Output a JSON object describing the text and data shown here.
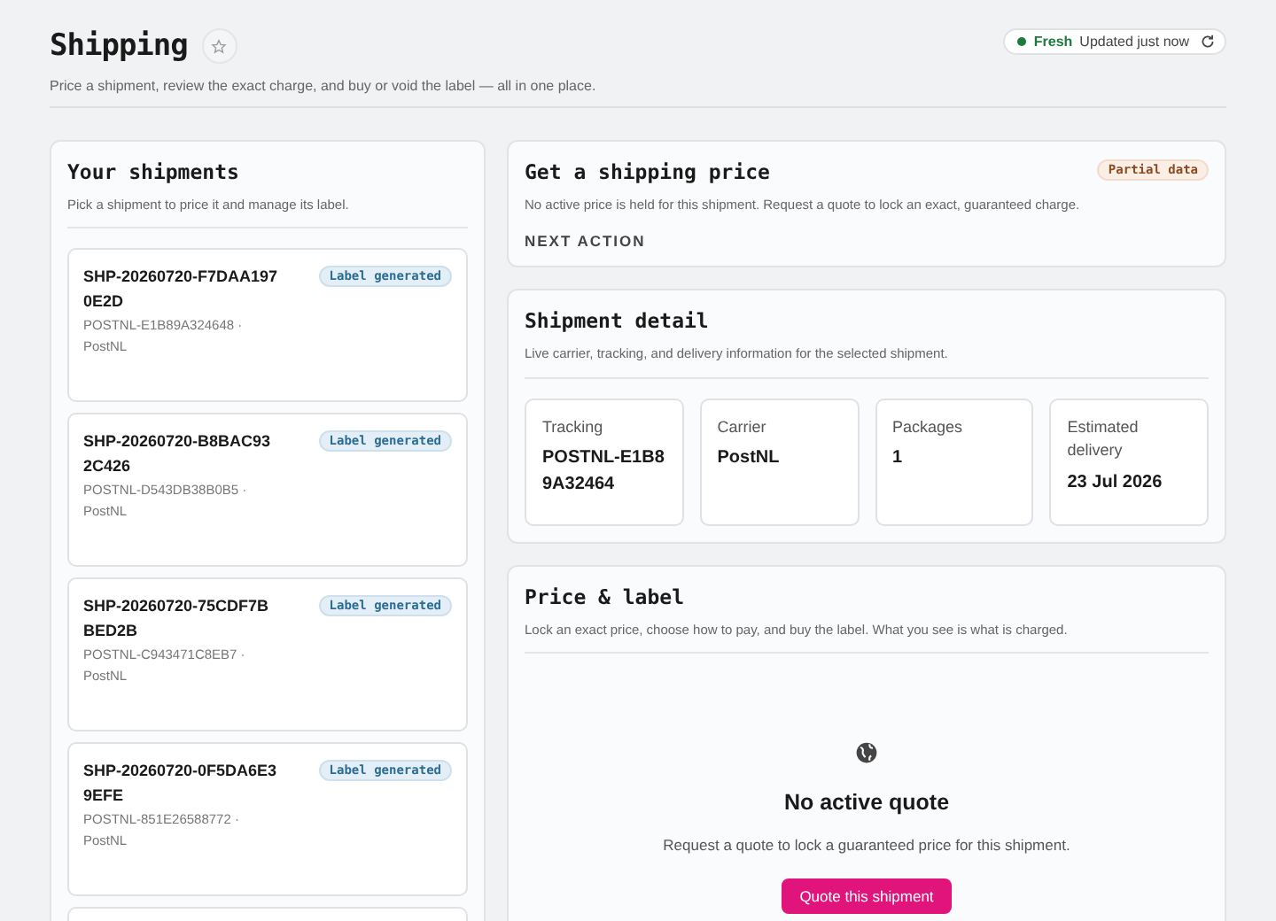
{
  "header": {
    "title": "Shipping",
    "subtitle": "Price a shipment, review the exact charge, and buy or void the label — all in one place.",
    "freshness": {
      "status": "Fresh",
      "updated": "Updated just now"
    }
  },
  "shipments_panel": {
    "title": "Your shipments",
    "subtitle": "Pick a shipment to price it and manage its label.",
    "items": [
      {
        "id": "SHP-20260720-F7DAA1970E2D",
        "tracking": "POSTNL-E1B89A324648 ·",
        "carrier": "PostNL",
        "badge": "Label generated"
      },
      {
        "id": "SHP-20260720-B8BAC932C426",
        "tracking": "POSTNL-D543DB38B0B5 ·",
        "carrier": "PostNL",
        "badge": "Label generated"
      },
      {
        "id": "SHP-20260720-75CDF7BBED2B",
        "tracking": "POSTNL-C943471C8EB7 ·",
        "carrier": "PostNL",
        "badge": "Label generated"
      },
      {
        "id": "SHP-20260720-0F5DA6E39EFE",
        "tracking": "POSTNL-851E26588772 ·",
        "carrier": "PostNL",
        "badge": "Label generated"
      }
    ]
  },
  "price_panel": {
    "title": "Get a shipping price",
    "badge": "Partial data",
    "text": "No active price is held for this shipment. Request a quote to lock an exact, guaranteed charge.",
    "next_action": "NEXT ACTION"
  },
  "detail_panel": {
    "title": "Shipment detail",
    "subtitle": "Live carrier, tracking, and delivery information for the selected shipment.",
    "fields": [
      {
        "label": "Tracking",
        "value": "POSTNL-E1B89A32464"
      },
      {
        "label": "Carrier",
        "value": "PostNL"
      },
      {
        "label": "Packages",
        "value": "1"
      },
      {
        "label": "Estimated delivery",
        "value": "23 Jul 2026"
      }
    ]
  },
  "label_panel": {
    "title": "Price & label",
    "subtitle": "Lock an exact price, choose how to pay, and buy the label. What you see is what is charged.",
    "empty_title": "No active quote",
    "empty_text": "Request a quote to lock a guaranteed price for this shipment.",
    "button": "Quote this shipment"
  }
}
